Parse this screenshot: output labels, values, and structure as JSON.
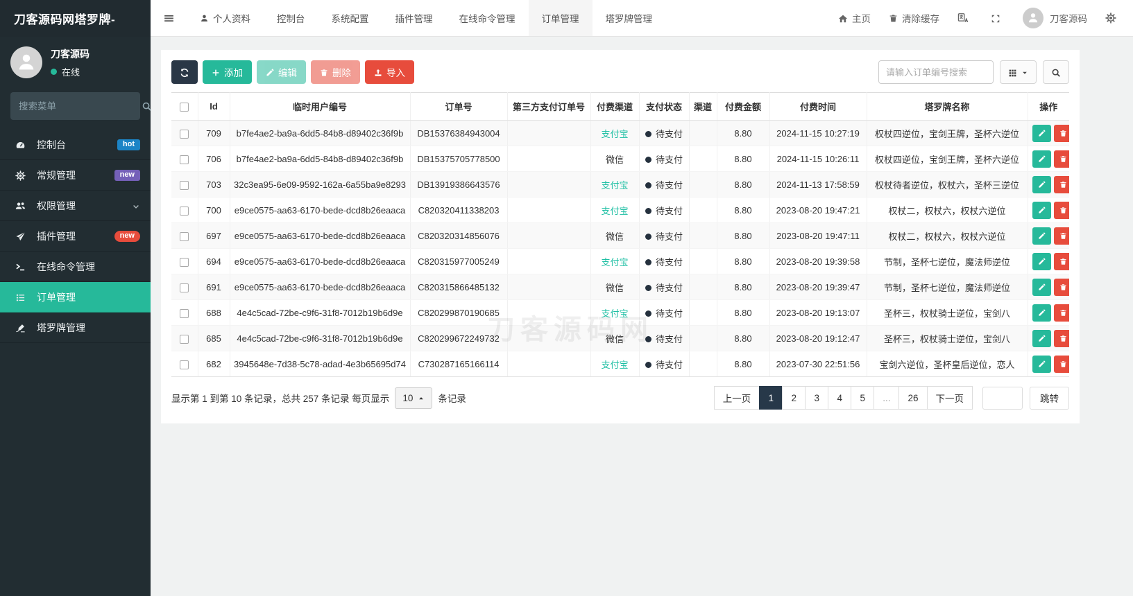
{
  "brand": {
    "logo_text": "刀客源码网塔罗牌-"
  },
  "topnav": {
    "tabs": [
      {
        "name": "tab-profile",
        "label": "个人资料",
        "icon": "user",
        "active": false
      },
      {
        "name": "tab-console",
        "label": "控制台",
        "active": false
      },
      {
        "name": "tab-system-config",
        "label": "系统配置",
        "active": false
      },
      {
        "name": "tab-plugin-manage",
        "label": "插件管理",
        "active": false
      },
      {
        "name": "tab-online-command",
        "label": "在线命令管理",
        "active": false
      },
      {
        "name": "tab-order-manage",
        "label": "订单管理",
        "active": true
      },
      {
        "name": "tab-tarot-manage",
        "label": "塔罗牌管理",
        "active": false
      }
    ],
    "right": {
      "home_label": "主页",
      "clear_cache_label": "清除缓存",
      "username": "刀客源码"
    }
  },
  "sidebar": {
    "username": "刀客源码",
    "status": "在线",
    "search_placeholder": "搜索菜单",
    "items": [
      {
        "name": "sidebar-item-console",
        "label": "控制台",
        "icon": "dashboard-icon",
        "badge": "hot",
        "badge_color": "#1c84c6",
        "badge_shape": "square"
      },
      {
        "name": "sidebar-item-general",
        "label": "常规管理",
        "icon": "gears-icon",
        "badge": "new",
        "badge_color": "#7460b8",
        "badge_shape": "square"
      },
      {
        "name": "sidebar-item-permission",
        "label": "权限管理",
        "icon": "users-icon",
        "chevron": true
      },
      {
        "name": "sidebar-item-plugin",
        "label": "插件管理",
        "icon": "rocket-icon",
        "badge": "new",
        "badge_color": "#e74c3c",
        "badge_shape": "pill"
      },
      {
        "name": "sidebar-item-online-command",
        "label": "在线命令管理",
        "icon": "terminal-icon"
      },
      {
        "name": "sidebar-item-order",
        "label": "订单管理",
        "icon": "list-icon",
        "active": true
      },
      {
        "name": "sidebar-item-tarot",
        "label": "塔罗牌管理",
        "icon": "signature-icon"
      }
    ]
  },
  "toolbar": {
    "add_label": "添加",
    "edit_label": "编辑",
    "delete_label": "删除",
    "import_label": "导入",
    "search_placeholder": "请输入订单编号搜索"
  },
  "table": {
    "columns": [
      "Id",
      "临时用户编号",
      "订单号",
      "第三方支付订单号",
      "付费渠道",
      "支付状态",
      "渠道",
      "付费金额",
      "付费时间",
      "塔罗牌名称",
      "操作"
    ],
    "pending_status": "待支付",
    "rows": [
      {
        "id": "709",
        "user_no": "b7fe4ae2-ba9a-6dd5-84b8-d89402c36f9b",
        "order_no": "DB15376384943004",
        "third_no": "",
        "pay_channel": "支付宝",
        "status": "待支付",
        "channel": "",
        "amount": "8.80",
        "pay_time": "2024-11-15 10:27:19",
        "tarot": "权杖四逆位，宝剑王牌，圣杯六逆位"
      },
      {
        "id": "706",
        "user_no": "b7fe4ae2-ba9a-6dd5-84b8-d89402c36f9b",
        "order_no": "DB15375705778500",
        "third_no": "",
        "pay_channel": "微信",
        "status": "待支付",
        "channel": "",
        "amount": "8.80",
        "pay_time": "2024-11-15 10:26:11",
        "tarot": "权杖四逆位，宝剑王牌，圣杯六逆位"
      },
      {
        "id": "703",
        "user_no": "32c3ea95-6e09-9592-162a-6a55ba9e8293",
        "order_no": "DB13919386643576",
        "third_no": "",
        "pay_channel": "支付宝",
        "status": "待支付",
        "channel": "",
        "amount": "8.80",
        "pay_time": "2024-11-13 17:58:59",
        "tarot": "权杖待者逆位，权杖六，圣杯三逆位"
      },
      {
        "id": "700",
        "user_no": "e9ce0575-aa63-6170-bede-dcd8b26eaaca",
        "order_no": "C820320411338203",
        "third_no": "",
        "pay_channel": "支付宝",
        "status": "待支付",
        "channel": "",
        "amount": "8.80",
        "pay_time": "2023-08-20 19:47:21",
        "tarot": "权杖二，权杖六，权杖六逆位"
      },
      {
        "id": "697",
        "user_no": "e9ce0575-aa63-6170-bede-dcd8b26eaaca",
        "order_no": "C820320314856076",
        "third_no": "",
        "pay_channel": "微信",
        "status": "待支付",
        "channel": "",
        "amount": "8.80",
        "pay_time": "2023-08-20 19:47:11",
        "tarot": "权杖二，权杖六，权杖六逆位"
      },
      {
        "id": "694",
        "user_no": "e9ce0575-aa63-6170-bede-dcd8b26eaaca",
        "order_no": "C820315977005249",
        "third_no": "",
        "pay_channel": "支付宝",
        "status": "待支付",
        "channel": "",
        "amount": "8.80",
        "pay_time": "2023-08-20 19:39:58",
        "tarot": "节制，圣杯七逆位，魔法师逆位"
      },
      {
        "id": "691",
        "user_no": "e9ce0575-aa63-6170-bede-dcd8b26eaaca",
        "order_no": "C820315866485132",
        "third_no": "",
        "pay_channel": "微信",
        "status": "待支付",
        "channel": "",
        "amount": "8.80",
        "pay_time": "2023-08-20 19:39:47",
        "tarot": "节制，圣杯七逆位，魔法师逆位"
      },
      {
        "id": "688",
        "user_no": "4e4c5cad-72be-c9f6-31f8-7012b19b6d9e",
        "order_no": "C820299870190685",
        "third_no": "",
        "pay_channel": "支付宝",
        "status": "待支付",
        "channel": "",
        "amount": "8.80",
        "pay_time": "2023-08-20 19:13:07",
        "tarot": "圣杯三，权杖骑士逆位，宝剑八"
      },
      {
        "id": "685",
        "user_no": "4e4c5cad-72be-c9f6-31f8-7012b19b6d9e",
        "order_no": "C820299672249732",
        "third_no": "",
        "pay_channel": "微信",
        "status": "待支付",
        "channel": "",
        "amount": "8.80",
        "pay_time": "2023-08-20 19:12:47",
        "tarot": "圣杯三，权杖骑士逆位，宝剑八"
      },
      {
        "id": "682",
        "user_no": "3945648e-7d38-5c78-adad-4e3b65695d74",
        "order_no": "C730287165166114",
        "third_no": "",
        "pay_channel": "支付宝",
        "status": "待支付",
        "channel": "",
        "amount": "8.80",
        "pay_time": "2023-07-30 22:51:56",
        "tarot": "宝剑六逆位，圣杯皇后逆位，恋人"
      }
    ]
  },
  "pagination": {
    "summary_prefix": "显示第 1 到第 10 条记录，总共 257 条记录 每页显示",
    "page_size": "10",
    "summary_suffix": "条记录",
    "prev_label": "上一页",
    "next_label": "下一页",
    "pages": [
      "1",
      "2",
      "3",
      "4",
      "5",
      "...",
      "26"
    ],
    "active_page": "1",
    "jump_value": "",
    "jump_label": "跳转"
  },
  "watermark": "刀客源码网",
  "colors": {
    "sidebar_dark": "#222d32",
    "accent_teal": "#26b99a",
    "danger_red": "#e74c3c",
    "dark_navy": "#273849",
    "badge_blue": "#1c84c6",
    "badge_purple": "#7460b8",
    "alipay_link": "#1dbfa3"
  }
}
